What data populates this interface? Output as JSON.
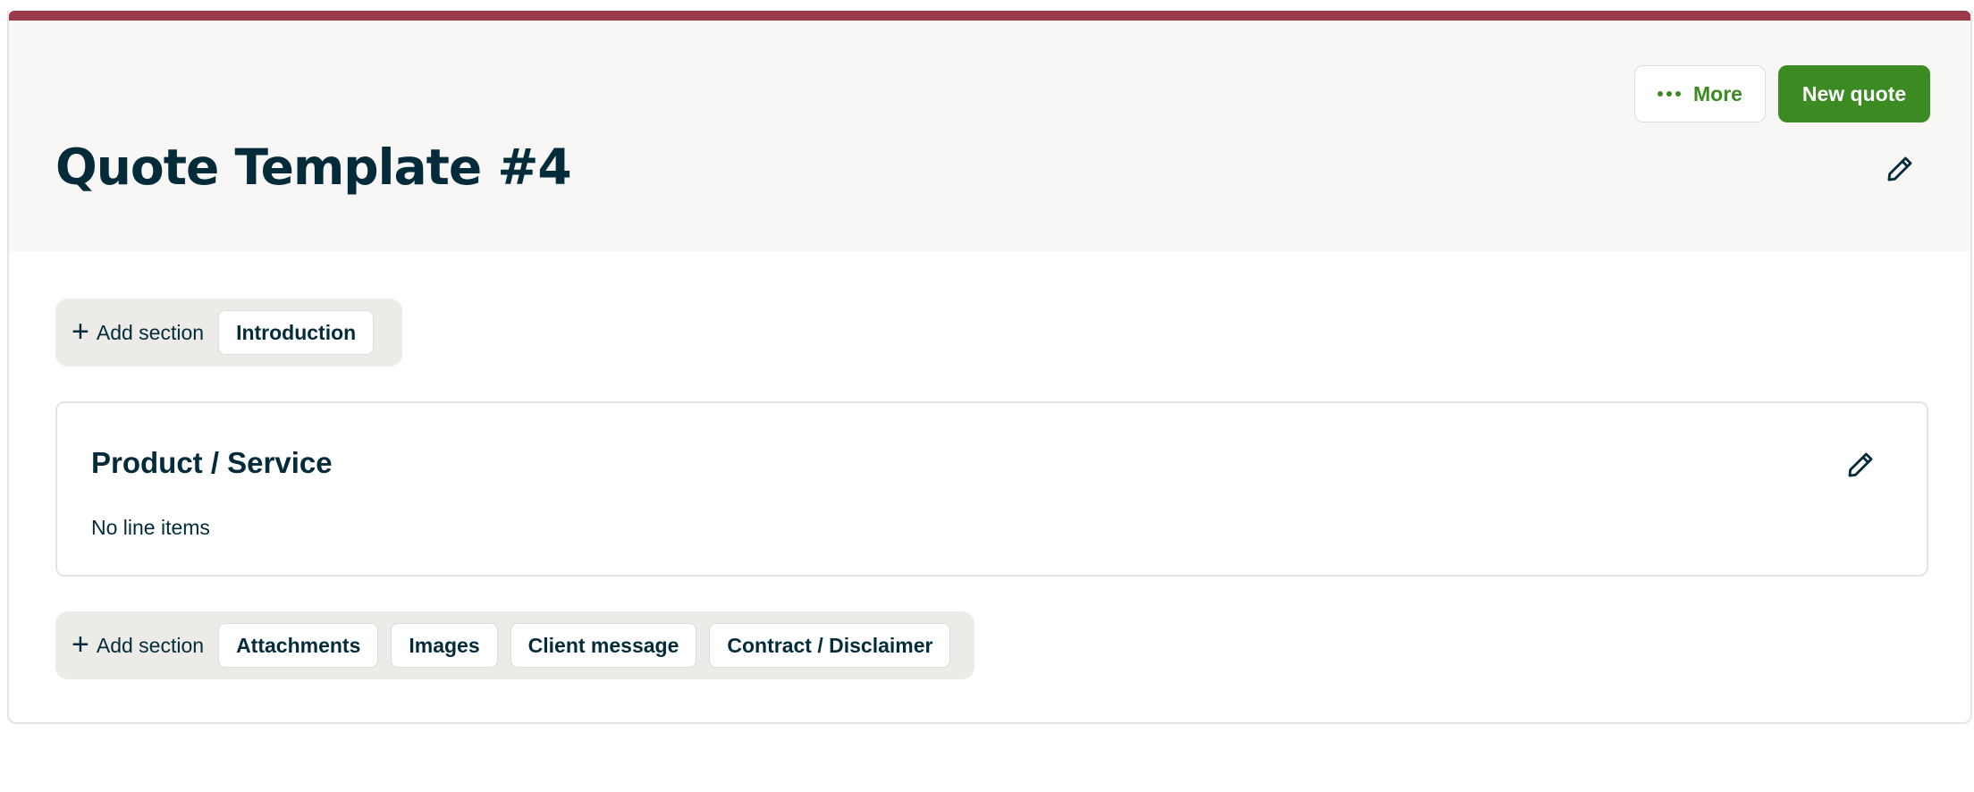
{
  "header": {
    "title": "Quote Template #4",
    "more_label": "More",
    "new_quote_label": "New quote",
    "more_icon": "ellipsis-icon",
    "edit_icon": "pencil-icon"
  },
  "add_bar_top": {
    "add_label": "Add section",
    "chips": [
      "Introduction"
    ]
  },
  "product_section": {
    "title": "Product / Service",
    "empty_text": "No line items"
  },
  "add_bar_bottom": {
    "add_label": "Add section",
    "chips": [
      "Attachments",
      "Images",
      "Client message",
      "Contract / Disclaimer"
    ]
  },
  "colors": {
    "accent_bar": "#9a3a48",
    "primary_green": "#3b8a22",
    "heading_text": "#032b3a"
  }
}
